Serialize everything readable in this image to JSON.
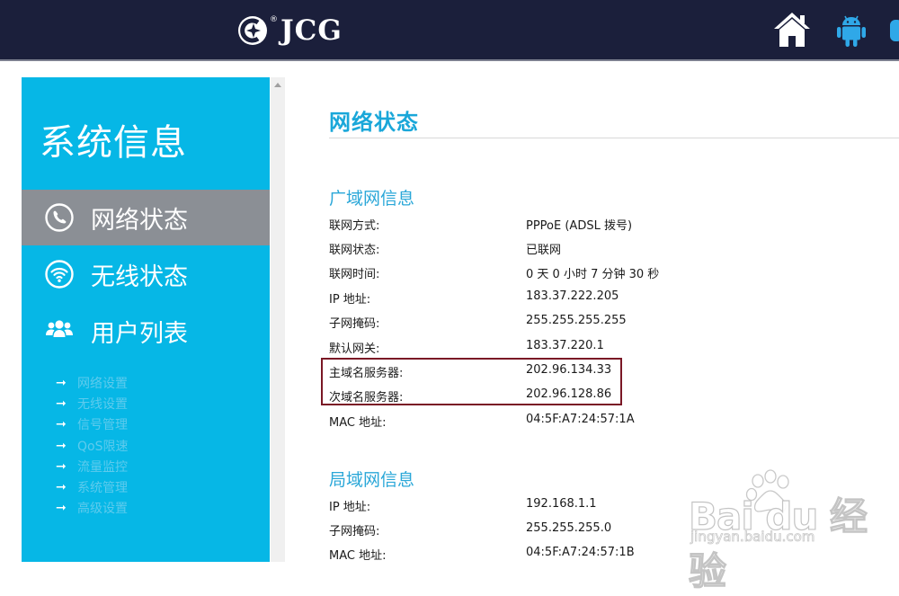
{
  "header": {
    "brand": "JCG",
    "brand_mark": "®",
    "icons": [
      "home-icon",
      "android-icon"
    ]
  },
  "sidebar": {
    "title": "系统信息",
    "items": [
      {
        "label": "网络状态",
        "icon": "phone-circle-icon",
        "active": true
      },
      {
        "label": "无线状态",
        "icon": "wifi-icon",
        "active": false
      },
      {
        "label": "用户列表",
        "icon": "users-icon",
        "active": false
      }
    ],
    "sub_items": [
      "网络设置",
      "无线设置",
      "信号管理",
      "QoS限速",
      "流量监控",
      "系统管理",
      "高级设置"
    ],
    "sub_arrow": "➞"
  },
  "main": {
    "title": "网络状态",
    "wan": {
      "title": "广域网信息",
      "rows": [
        {
          "label": "联网方式:",
          "value": "PPPoE (ADSL 拨号)"
        },
        {
          "label": "联网状态:",
          "value": "已联网"
        },
        {
          "label": "联网时间:",
          "value": "0 天 0 小时 7 分钟 30 秒"
        },
        {
          "label": "IP 地址:",
          "value": "183.37.222.205"
        },
        {
          "label": "子网掩码:",
          "value": "255.255.255.255"
        },
        {
          "label": "默认网关:",
          "value": "183.37.220.1"
        },
        {
          "label": "主域名服务器:",
          "value": "202.96.134.33"
        },
        {
          "label": "次域名服务器:",
          "value": "202.96.128.86"
        },
        {
          "label": "MAC 地址:",
          "value": "04:5F:A7:24:57:1A"
        }
      ]
    },
    "lan": {
      "title": "局域网信息",
      "rows": [
        {
          "label": "IP 地址:",
          "value": "192.168.1.1"
        },
        {
          "label": "子网掩码:",
          "value": "255.255.255.0"
        },
        {
          "label": "MAC 地址:",
          "value": "04:5F:A7:24:57:1B"
        }
      ]
    }
  },
  "watermark": {
    "text": "Bai du 经验",
    "sub": "jingyan.baidu.com"
  },
  "colors": {
    "header_bg": "#1b1f3b",
    "sidebar_bg": "#06b7e6",
    "active_item_bg": "#8b8f95",
    "accent": "#1aa7d9",
    "highlight_border": "#7a1725",
    "android_green": "#2fa8e8"
  }
}
